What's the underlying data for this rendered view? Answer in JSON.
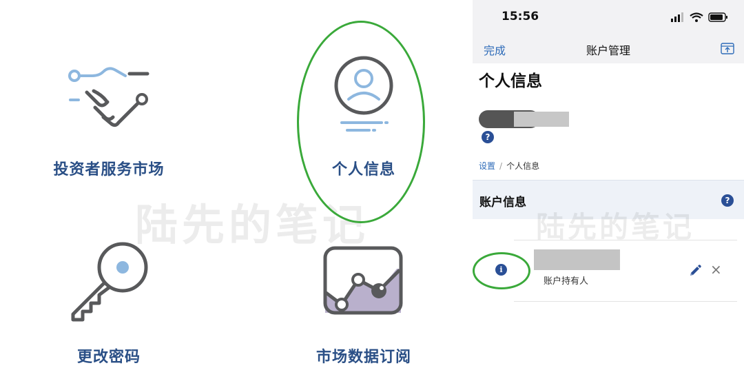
{
  "left_menu": {
    "tiles": [
      {
        "label": "投资者服务市场",
        "icon": "handshake-icon"
      },
      {
        "label": "个人信息",
        "icon": "user-profile-icon"
      },
      {
        "label": "更改密码",
        "icon": "key-icon"
      },
      {
        "label": "市场数据订阅",
        "icon": "line-chart-icon"
      }
    ],
    "watermark": "陆先的笔记"
  },
  "phone": {
    "status_bar": {
      "time": "15:56",
      "icons": [
        "signal-icon",
        "wifi-icon",
        "battery-icon"
      ]
    },
    "nav": {
      "done_label": "完成",
      "title": "账户管理",
      "share_icon": "share-icon"
    },
    "page_title": "个人信息",
    "help_label": "?",
    "breadcrumb": {
      "parent": "设置",
      "separator": "/",
      "current": "个人信息"
    },
    "section": {
      "title": "账户信息",
      "help_label": "?"
    },
    "account_row": {
      "info_label": "i",
      "role": "账户持有人",
      "close_label": "×"
    },
    "watermark": "陆先的笔记"
  },
  "colors": {
    "label_blue": "#2a4f86",
    "link_blue": "#2d6bb8",
    "badge_blue": "#2a4f96",
    "highlight_green": "#3aa93a",
    "icon_gray": "#58595b",
    "icon_light_blue": "#8db7df",
    "chart_fill": "#b9b0cc"
  }
}
